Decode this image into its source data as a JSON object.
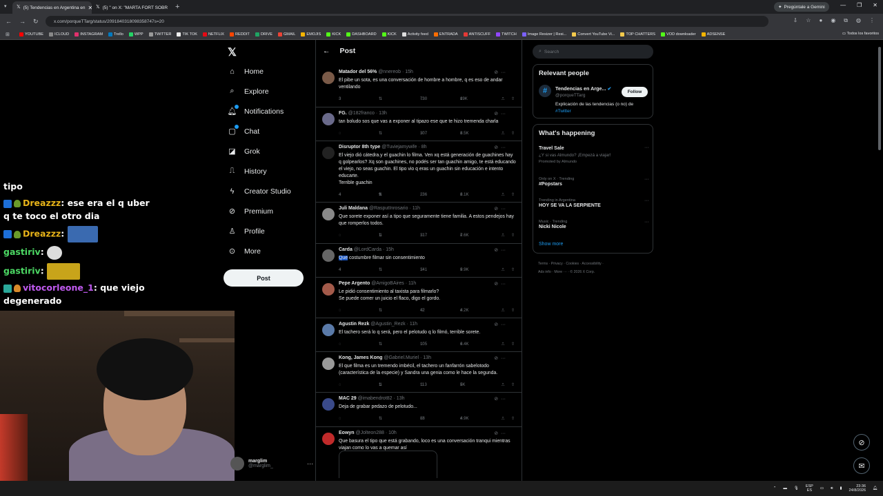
{
  "browser": {
    "tabs": [
      {
        "title": "(5) Tendencias en Argentina en",
        "active": true
      },
      {
        "title": "(5) \" on X: \"MARTA FORT SOBR",
        "active": false
      }
    ],
    "gemini_button": "Pregúntale a Gemini",
    "url": "x.com/porqueTTarg/status/2091840318098358747s=20",
    "bookmarks": [
      "YOUTUBE",
      "ICLOUD",
      "INSTAGRAM",
      "Trello",
      "WPP",
      "TWITTER",
      "TIK TOK",
      "NETFLIX",
      "REDDIT",
      "DRIVE",
      "GMAIL",
      "EMOJIS",
      "KICK",
      "DASHBOARD",
      "KICK",
      "Activity feed",
      "ENTRADA",
      "ANTISCUFF",
      "TWITCH",
      "Image Resizer | Resi...",
      "Convert YouTube Vi...",
      "TOP CHATTERS",
      "VOD downloader",
      "ADSENSE"
    ],
    "bookmarks_all": "Todos los favoritos"
  },
  "stream_chat": [
    {
      "user": "",
      "message": "tipo"
    },
    {
      "user": "Dreazzz",
      "message": "ese era el q uber"
    },
    {
      "user": "",
      "message": "q te toco el otro dia"
    },
    {
      "user": "Dreazzz",
      "message": ""
    },
    {
      "user": "gastiriv",
      "message": ""
    },
    {
      "user": "gastiriv",
      "message": ""
    },
    {
      "user": "vitocorleone_1",
      "message": "que viejo"
    },
    {
      "user": "",
      "message": "degenerado"
    }
  ],
  "x_nav": {
    "items": [
      "Home",
      "Explore",
      "Notifications",
      "Chat",
      "Grok",
      "History",
      "Creator Studio",
      "Premium",
      "Profile",
      "More"
    ],
    "post_button": "Post",
    "account_name": "marglim",
    "account_handle": "@marglim_"
  },
  "main": {
    "title": "Post",
    "tweets": [
      {
        "name": "Matador del 56%",
        "handle": "@nnereob",
        "time": "15h",
        "text": "El pibe un sota, es una conversación de hombre a hombre, q es eso de andar ventilando",
        "replies": "3",
        "reposts": "",
        "likes": "730",
        "views": "19K",
        "avatar_color": "#7a5a48"
      },
      {
        "name": "FG.",
        "handle": "@182franco",
        "time": "13h",
        "text": "tan boludo sos que vas a exponer al tipazo ese que te hizo tremenda charla",
        "replies": "",
        "reposts": "",
        "likes": "307",
        "views": "8.5K",
        "avatar_color": "#6a6a8a"
      },
      {
        "name": "Disruptor 8th type",
        "handle": "@Tuviejamywife",
        "time": "8h",
        "text": "El viejo dió cátedra.y el guachin lo filma. Ven xq está generación de guachines  hay q golpearlos? Xq son guachines, no podés ser tan guachin amigo, te está educando el viejo, no seas guachin. El tipo vio q eras un guachin sin educación e intento educarte.\nTerrible guachin",
        "replies": "4",
        "reposts": "9",
        "likes": "236",
        "views": "8.1K",
        "avatar_color": "#222"
      },
      {
        "name": "Juli Maldana",
        "handle": "@RasputInrosario",
        "time": "11h",
        "text": "Que sorete exponer así a tipo que seguramente tiene familia. A estos pendejos hay que romperlos todos.",
        "replies": "",
        "reposts": "1",
        "likes": "317",
        "views": "7.6K",
        "avatar_color": "#888"
      },
      {
        "name": "Carda",
        "handle": "@LordCarda",
        "time": "15h",
        "text_hl": "Que",
        "text": " costumbre filmar sin consentimiento",
        "replies": "4",
        "reposts": "",
        "likes": "341",
        "views": "9.9K",
        "avatar_color": "#666"
      },
      {
        "name": "Pepe Argento",
        "handle": "@AmigoBAires",
        "time": "11h",
        "text": "Le pidió consentimiento al taxista para filmarlo?\nSe puede comer un juicio el flaco, digo el gordo.",
        "replies": "",
        "reposts": "",
        "likes": "42",
        "views": "4.2K",
        "avatar_color": "#a35a4a"
      },
      {
        "name": "Agustin Rezk",
        "handle": "@Agustin_Rezk",
        "time": "11h",
        "text": "El tachero será lo q será, pero el pelotudo q lo filmó, terrible sorete.",
        "replies": "",
        "reposts": "",
        "likes": "105",
        "views": "6.4K",
        "avatar_color": "#5a7aa8"
      },
      {
        "name": "Kong, James Kong",
        "handle": "@Gabriel.Muriel",
        "time": "13h",
        "text": "El que filma es un tremendo imbécil, el tachero un fanfarrón sabelotodo (característica de la especie) y Sandra una genia como le hace la segunda.",
        "replies": "",
        "reposts": "1",
        "likes": "113",
        "views": "5K",
        "avatar_color": "#999"
      },
      {
        "name": "MAC 29",
        "handle": "@imabendrot82",
        "time": "13h",
        "text": "Deja de grabar pedazo de pelotudo...",
        "replies": "",
        "reposts": "",
        "likes": "88",
        "views": "4.9K",
        "avatar_color": "#3a4a8a"
      },
      {
        "name": "Eowyn",
        "handle": "@Jolteon288",
        "time": "10h",
        "text": "Que basura el tipo que está grabando, loco es una conversación tranqui mientras viajan como lo vas a quemar así",
        "replies": "",
        "reposts": "",
        "likes": "",
        "views": "",
        "avatar_color": "#c02a2a"
      }
    ]
  },
  "right": {
    "search_placeholder": "Search",
    "relevant_title": "Relevant people",
    "person_name": "Tendencias en Arge...",
    "person_handle": "@porqueTTarg",
    "follow_label": "Follow",
    "person_bio": "Explicación de las tendencias (o no) de",
    "person_bio_tag": "#Twitter",
    "happening_title": "What's happening",
    "trends": [
      {
        "context": "",
        "title": "Travel Sale",
        "sub1": "¿Y si vas Almundo? ¡Empezá a viajar!",
        "sub2": "Promoted by Almundo"
      },
      {
        "context": "Only on X · Trending",
        "title": "#Popstars",
        "sub1": "",
        "sub2": ""
      },
      {
        "context": "Trending in Argentina",
        "title": "HOY SE VA LA SERPIENTE",
        "sub1": "",
        "sub2": ""
      },
      {
        "context": "Music · Trending",
        "title": "Nicki Nicole",
        "sub1": "",
        "sub2": ""
      }
    ],
    "show_more": "Show more",
    "footer1": "Terms  ·  Privacy  ·  Cookies  ·  Accessibility  ·",
    "footer2": "Ads info  ·  More ···  ·  © 2026 X Corp."
  },
  "taskbar": {
    "lang1": "ESP",
    "lang2": "ES",
    "time": "23:36",
    "date": "24/8/2026"
  },
  "colors": {
    "accent": "#1d9bf0",
    "border": "#2f3336",
    "muted": "#71767b"
  }
}
